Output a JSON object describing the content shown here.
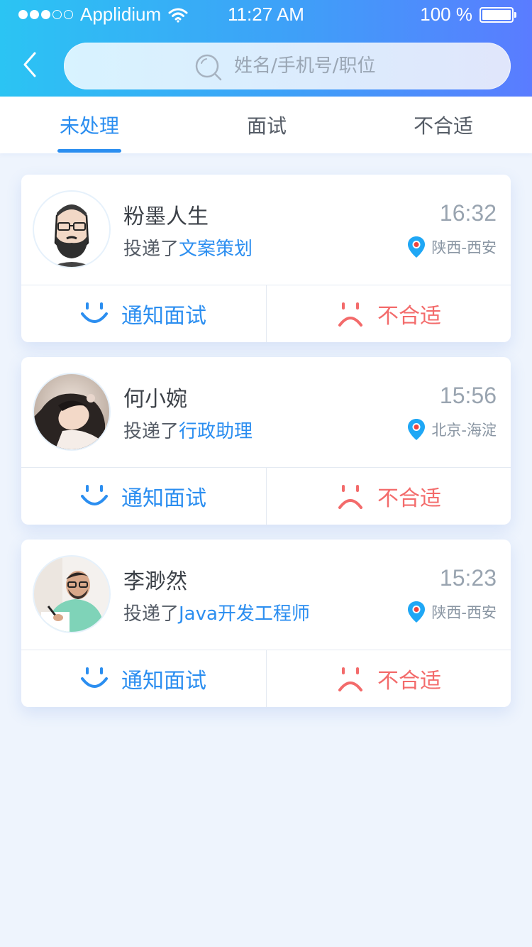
{
  "status_bar": {
    "carrier": "Applidium",
    "time": "11:27 AM",
    "battery": "100 %",
    "signal_dots": 5,
    "signal_filled": 3
  },
  "search": {
    "placeholder": "姓名/手机号/职位"
  },
  "tabs": [
    {
      "label": "未处理",
      "active": true
    },
    {
      "label": "面试",
      "active": false
    },
    {
      "label": "不合适",
      "active": false
    }
  ],
  "applicants": [
    {
      "name": "粉墨人生",
      "applied_prefix": "投递了",
      "job": "文案策划",
      "time": "16:32",
      "location": "陕西-西安",
      "notify_label": "通知面试",
      "reject_label": "不合适"
    },
    {
      "name": "何小婉",
      "applied_prefix": "投递了",
      "job": "行政助理",
      "time": "15:56",
      "location": "北京-海淀",
      "notify_label": "通知面试",
      "reject_label": "不合适"
    },
    {
      "name": "李渺然",
      "applied_prefix": "投递了",
      "job": "Java开发工程师",
      "time": "15:23",
      "location": "陕西-西安",
      "notify_label": "通知面试",
      "reject_label": "不合适"
    }
  ],
  "colors": {
    "accent": "#2b8ef0",
    "reject": "#f36b6b",
    "location_pin": "#1fa7f5"
  }
}
